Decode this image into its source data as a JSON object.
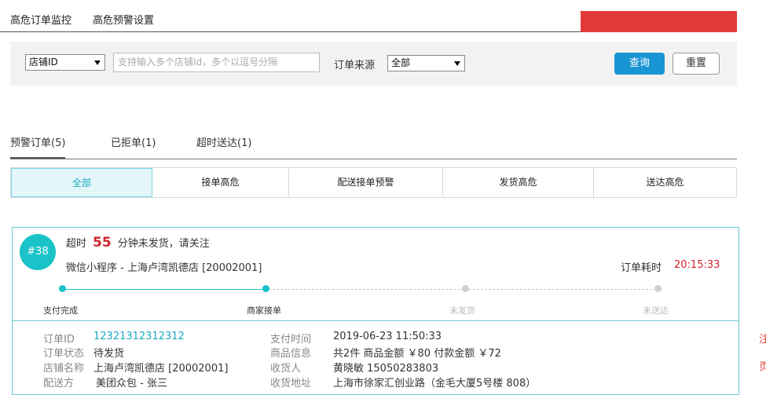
{
  "top_tabs": [
    "高危订单监控",
    "高危预警设置"
  ],
  "filter": {
    "store_select": "店铺ID",
    "store_input_placeholder": "支持输入多个店铺Id，多个以逗号分隔",
    "source_label": "订单来源",
    "source_select": "全部",
    "query_button": "查询",
    "reset_button": "重置"
  },
  "sub_tabs": [
    "预警订单(5)",
    "已拒单(1)",
    "超时送达(1)"
  ],
  "filter_tabs": [
    "全部",
    "接单高危",
    "配送接单预警",
    "发货高危",
    "送达高危"
  ],
  "order": {
    "badge": "#38",
    "alert_prefix": "超时",
    "alert_minutes": "55",
    "alert_suffix": "分钟未发货，请关注",
    "store_line": "微信小程序 - 上海卢湾凯德店 [20002001]",
    "elapsed_label": "订单耗时",
    "elapsed_value": "20:15:33",
    "steps": [
      "支付完成",
      "商家接单",
      "未发货",
      "未送达"
    ],
    "fields": {
      "order_id_label": "订单ID",
      "order_id": "12321312312312",
      "status_label": "订单状态",
      "status": "待发货",
      "store_label": "店铺名称",
      "store": "上海卢湾凯德店 [20002001]",
      "delivery_label": "配送方",
      "delivery": "美团众包 - 张三",
      "pay_time_label": "支付时间",
      "pay_time": "2019-06-23 11:50:33",
      "goods_label": "商品信息",
      "goods": "共2件  商品金额 ￥80  付款金额 ￥72",
      "receiver_label": "收货人",
      "receiver": "黄晓敏  15050283803",
      "address_label": "收货地址",
      "address": "上海市徐家汇创业路（金毛大厦5号楼 808）"
    }
  },
  "side_text": [
    "注",
    "页"
  ],
  "colors": {
    "accent": "#19c3c8",
    "primary_button": "#1a95d3",
    "alert": "#d0232b",
    "redacted_bar": "#e23a3a"
  }
}
